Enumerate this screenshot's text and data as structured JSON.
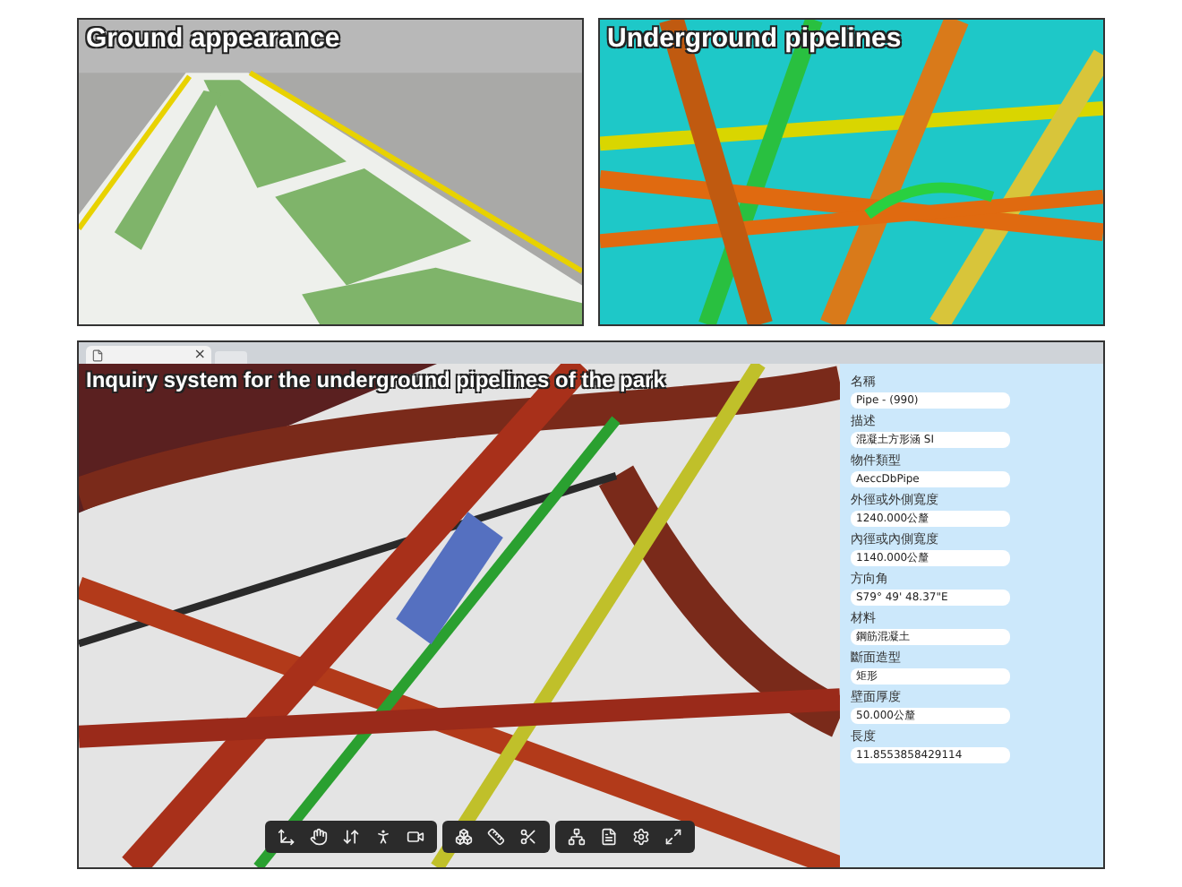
{
  "panels": [
    {
      "caption": "Ground appearance"
    },
    {
      "caption": "Underground pipelines"
    }
  ],
  "viewer": {
    "tab": {
      "close": "×"
    },
    "caption": "Inquiry system for the underground pipelines of the park",
    "properties": [
      {
        "label": "名稱",
        "value": "Pipe - (990)"
      },
      {
        "label": "描述",
        "value": "混凝土方形涵 SI"
      },
      {
        "label": "物件類型",
        "value": "AeccDbPipe"
      },
      {
        "label": "外徑或外側寬度",
        "value": "1240.000公釐"
      },
      {
        "label": "內徑或內側寬度",
        "value": "1140.000公釐"
      },
      {
        "label": "方向角",
        "value": "S79° 49' 48.37\"E"
      },
      {
        "label": "材料",
        "value": "鋼筋混凝土"
      },
      {
        "label": "斷面造型",
        "value": "矩形"
      },
      {
        "label": "壁面厚度",
        "value": "50.000公釐"
      },
      {
        "label": "長度",
        "value": "11.8553858429114"
      }
    ]
  }
}
